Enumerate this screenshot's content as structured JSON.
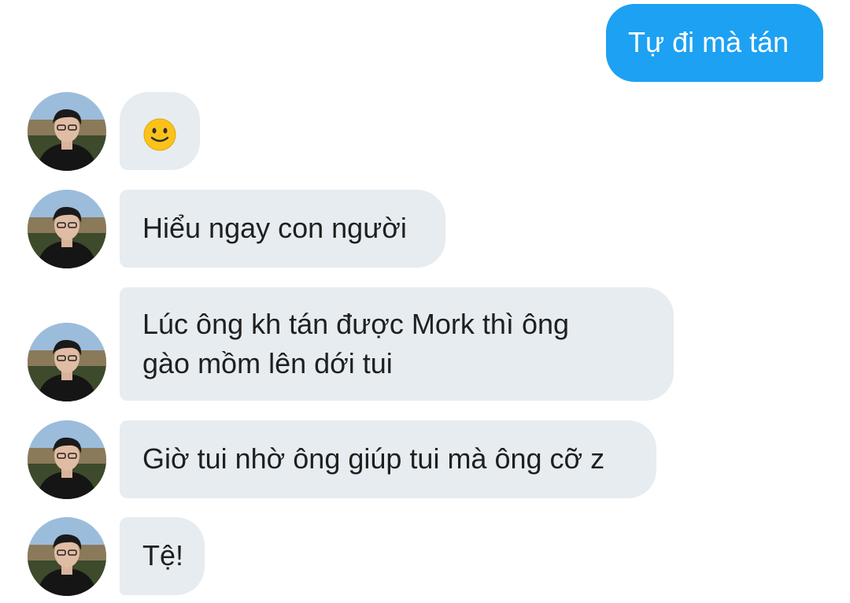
{
  "conversation": {
    "outgoing": [
      {
        "text": "Tự đi mà tán"
      }
    ],
    "incoming": [
      {
        "text": "",
        "icon": "slightly-smiling-face-emoji"
      },
      {
        "text": "Hiểu ngay con người"
      },
      {
        "text": "Lúc ông kh tán được Mork thì ông\ngào mồm lên dới tui"
      },
      {
        "text": "Giờ tui nhờ ông giúp tui mà ông cỡ z"
      },
      {
        "text": "Tệ!"
      }
    ]
  },
  "colors": {
    "outgoing_bubble": "#1da1f2",
    "incoming_bubble": "#e6ecf0",
    "text_dark": "#1f1f1f",
    "text_light": "#ffffff"
  }
}
